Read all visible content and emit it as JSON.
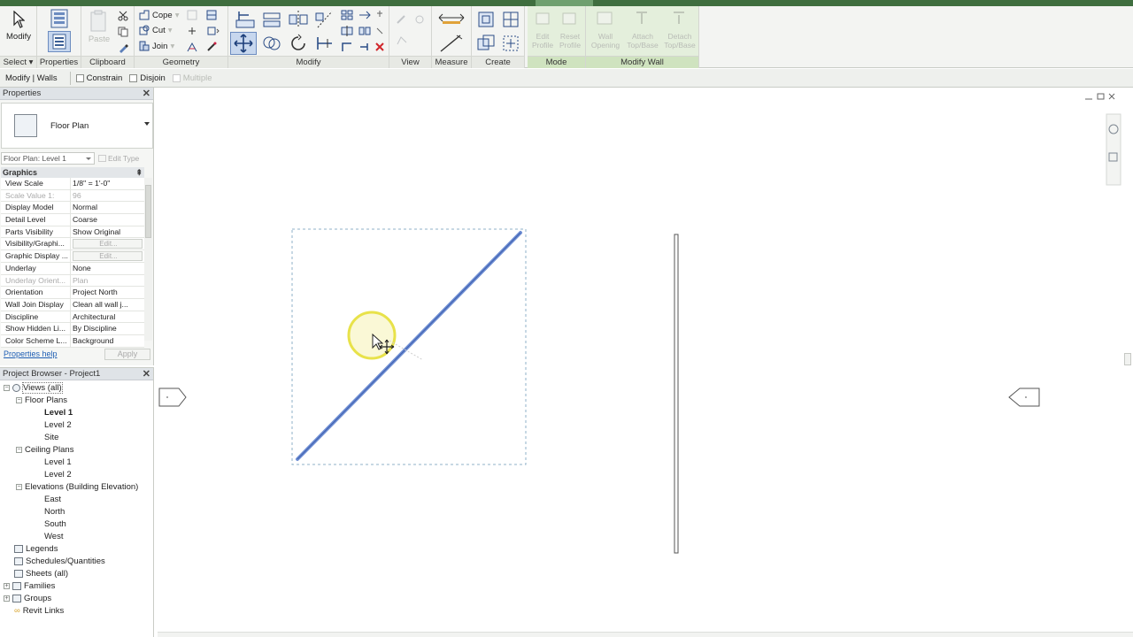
{
  "ribbon": {
    "modify_label": "Modify",
    "select_label": "Select",
    "properties_label": "Properties",
    "paste_label": "Paste",
    "cope_label": "Cope",
    "cut_label": "Cut",
    "join_label": "Join",
    "panels": {
      "clipboard": "Clipboard",
      "geometry": "Geometry",
      "modify": "Modify",
      "view": "View",
      "measure": "Measure",
      "create": "Create",
      "mode": "Mode",
      "modify_wall": "Modify Wall"
    },
    "mode_buttons": {
      "edit_profile": "Edit Profile",
      "reset_profile": "Reset Profile"
    },
    "modify_wall_buttons": {
      "wall_opening": "Wall Opening",
      "attach_top_base": "Attach Top/Base",
      "detach_top_base": "Detach Top/Base"
    }
  },
  "options_bar": {
    "context": "Modify | Walls",
    "constrain": "Constrain",
    "disjoin": "Disjoin",
    "multiple": "Multiple"
  },
  "properties": {
    "header": "Properties",
    "type_name": "Floor Plan",
    "instance_selector": "Floor Plan: Level 1",
    "edit_type": "Edit Type",
    "group": "Graphics",
    "rows": [
      {
        "k": "View Scale",
        "v": "1/8\" = 1'-0\""
      },
      {
        "k": "Scale Value    1:",
        "v": "96"
      },
      {
        "k": "Display Model",
        "v": "Normal"
      },
      {
        "k": "Detail Level",
        "v": "Coarse"
      },
      {
        "k": "Parts Visibility",
        "v": "Show Original"
      },
      {
        "k": "Visibility/Graphi...",
        "v": "Edit..."
      },
      {
        "k": "Graphic Display ...",
        "v": "Edit..."
      },
      {
        "k": "Underlay",
        "v": "None"
      },
      {
        "k": "Underlay Orient...",
        "v": "Plan"
      },
      {
        "k": "Orientation",
        "v": "Project North"
      },
      {
        "k": "Wall Join Display",
        "v": "Clean all wall j..."
      },
      {
        "k": "Discipline",
        "v": "Architectural"
      },
      {
        "k": "Show Hidden Li...",
        "v": "By Discipline"
      },
      {
        "k": "Color Scheme L...",
        "v": "Background"
      }
    ],
    "help_link": "Properties help",
    "apply": "Apply"
  },
  "browser": {
    "header": "Project Browser - Project1",
    "views_all": "Views (all)",
    "floor_plans": "Floor Plans",
    "fp_level1": "Level 1",
    "fp_level2": "Level 2",
    "fp_site": "Site",
    "ceiling_plans": "Ceiling Plans",
    "cp_level1": "Level 1",
    "cp_level2": "Level 2",
    "elevations": "Elevations (Building Elevation)",
    "east": "East",
    "north": "North",
    "south": "South",
    "west": "West",
    "legends": "Legends",
    "schedules": "Schedules/Quantities",
    "sheets": "Sheets (all)",
    "families": "Families",
    "groups": "Groups",
    "revit_links": "Revit Links"
  },
  "colors": {
    "wall_selected": "#6f8fd4",
    "cursor_highlight": "#e8e24a",
    "ribbon_context": "#cfe3bf"
  }
}
